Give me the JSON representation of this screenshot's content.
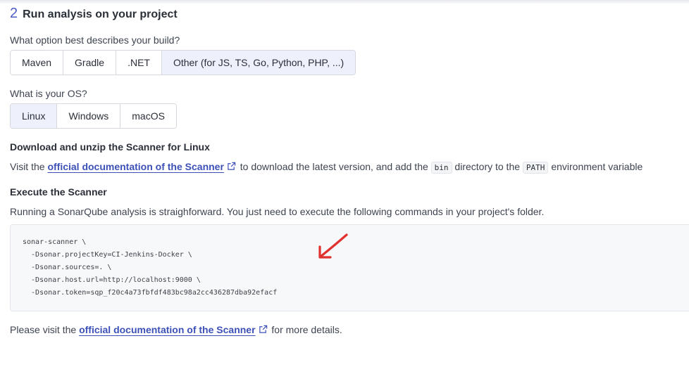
{
  "step": {
    "number": "2",
    "title": "Run analysis on your project"
  },
  "build": {
    "question": "What option best describes your build?",
    "options": [
      "Maven",
      "Gradle",
      ".NET",
      "Other (for JS, TS, Go, Python, PHP, ...)"
    ],
    "selected": "Other (for JS, TS, Go, Python, PHP, ...)"
  },
  "os": {
    "question": "What is your OS?",
    "options": [
      "Linux",
      "Windows",
      "macOS"
    ],
    "selected": "Linux"
  },
  "download": {
    "heading": "Download and unzip the Scanner for Linux",
    "text_before": "Visit the",
    "link": "official documentation of the Scanner",
    "text_middle": "to download the latest version, and add the",
    "code_bin": "bin",
    "text_middle2": "directory to the",
    "code_path": "PATH",
    "text_after": "environment variable"
  },
  "execute": {
    "heading": "Execute the Scanner",
    "text": "Running a SonarQube analysis is straighforward. You just need to execute the following commands in your project's folder.",
    "code_lines": [
      "sonar-scanner \\",
      "  -Dsonar.projectKey=CI-Jenkins-Docker \\",
      "  -Dsonar.sources=. \\",
      "  -Dsonar.host.url=http://localhost:9000 \\",
      "  -Dsonar.token=sqp_f20c4a73fbfdf483bc98a2cc436287dba92efacf"
    ]
  },
  "footer": {
    "text_before": "Please visit the",
    "link": "official documentation of the Scanner",
    "text_after": "for more details."
  },
  "colors": {
    "accent": "#3d50b8",
    "selected_bg": "#eef1fb",
    "annotation_arrow": "#e0312f"
  },
  "icons": {
    "external_link": "external-link-icon",
    "annotation": "red-arrow-annotation"
  }
}
